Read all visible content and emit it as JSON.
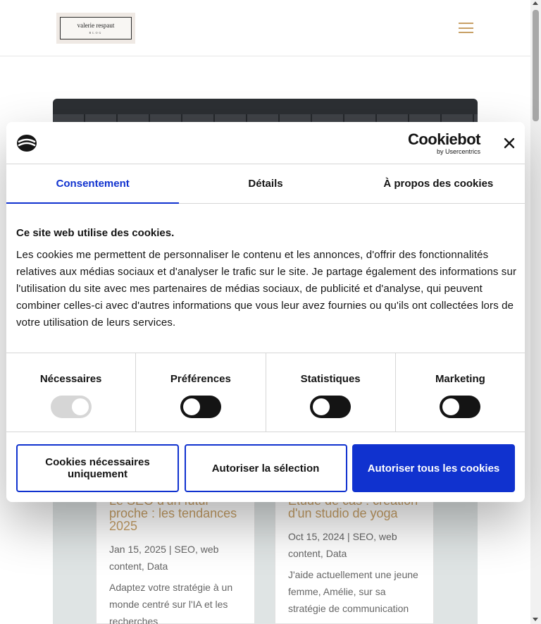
{
  "site": {
    "logo_name": "valerie respaut",
    "logo_sub": "BLOG"
  },
  "posts": [
    {
      "title": "Le SEO d'un futur proche : les tendances 2025",
      "meta": "Jan 15, 2025 | SEO, web content, Data",
      "excerpt": "Adaptez votre stratégie à un monde centré sur l'IA et les recherches"
    },
    {
      "title": "Etude de cas : création d'un studio de yoga",
      "meta": "Oct 15, 2024 | SEO, web content, Data",
      "excerpt": "J'aide actuellement une jeune femme, Amélie, sur sa stratégie de communication"
    }
  ],
  "cookie": {
    "brand_main": "Cookiebot",
    "brand_sub": "by Usercentrics",
    "tabs": [
      "Consentement",
      "Détails",
      "À propos des cookies"
    ],
    "heading": "Ce site web utilise des cookies.",
    "text": "Les cookies me permettent de personnaliser le contenu et les annonces, d'offrir des fonctionnalités relatives aux médias sociaux et d'analyser le trafic sur le site. Je partage également des informations sur l'utilisation du site avec mes partenaires de médias sociaux, de publicité et d'analyse, qui peuvent combiner celles-ci avec d'autres informations que vous leur avez fournies ou qu'ils ont collectées lors de votre utilisation de leurs services.",
    "categories": [
      {
        "label": "Nécessaires",
        "enabled": true,
        "locked": true
      },
      {
        "label": "Préférences",
        "enabled": false,
        "locked": false
      },
      {
        "label": "Statistiques",
        "enabled": false,
        "locked": false
      },
      {
        "label": "Marketing",
        "enabled": false,
        "locked": false
      }
    ],
    "buttons": {
      "necessary": "Cookies nécessaires uniquement",
      "selection": "Autoriser la sélection",
      "all": "Autoriser tous les cookies"
    }
  },
  "colors": {
    "accent": "#1032cf",
    "gold": "#c8a066",
    "text": "#141414"
  }
}
